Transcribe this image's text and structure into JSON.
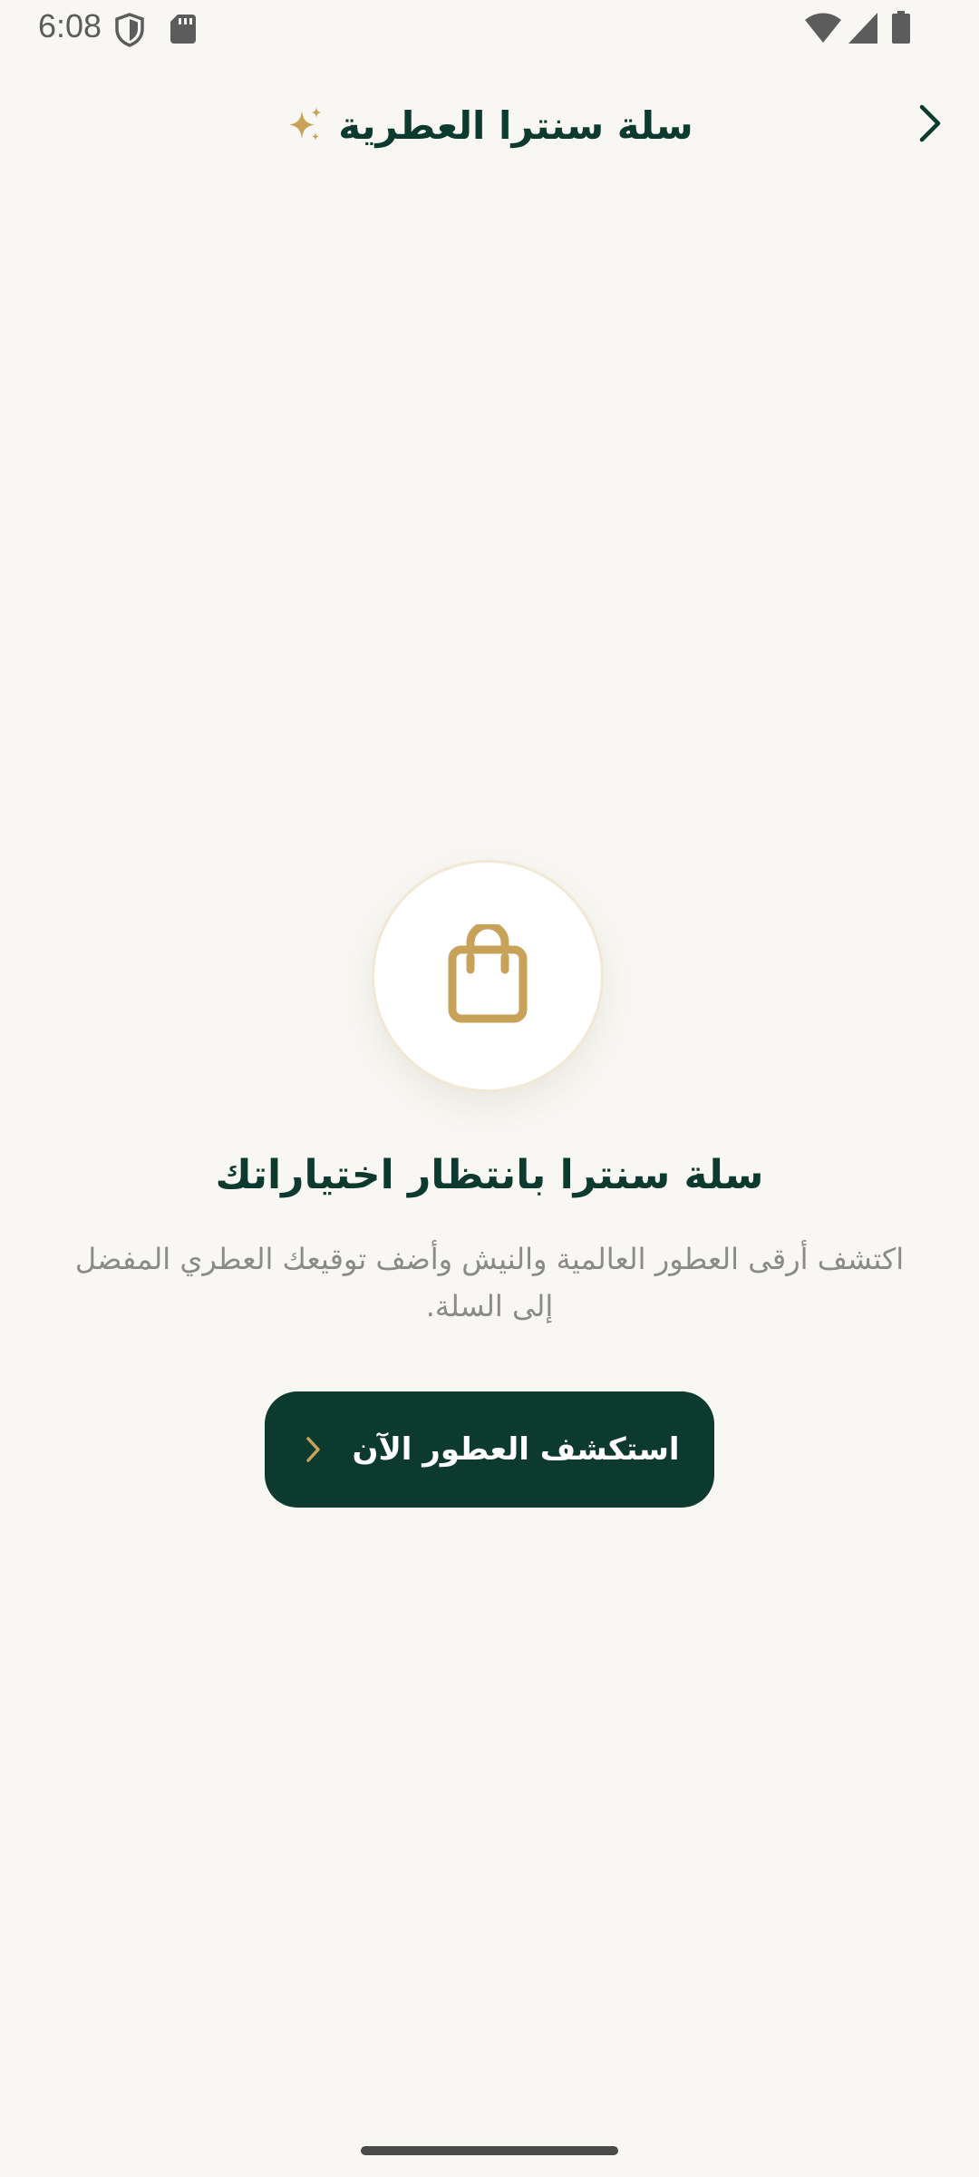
{
  "status_bar": {
    "time": "6:08",
    "icons_left": [
      "shield-icon",
      "sd-card-icon"
    ],
    "icons_right": [
      "wifi-icon",
      "signal-icon",
      "battery-icon"
    ]
  },
  "header": {
    "title": "سلة سنترا العطرية",
    "title_icon": "sparkle-icon",
    "back_icon": "chevron-right-icon"
  },
  "empty_state": {
    "icon": "shopping-bag-icon",
    "title": "سلة سنترا بانتظار اختياراتك",
    "description": "اكتشف أرقى العطور العالمية والنيش وأضف توقيعك العطري المفضل إلى السلة."
  },
  "cta": {
    "label": "استكشف العطور الآن",
    "icon": "chevron-left-icon"
  },
  "colors": {
    "background": "#f8f7f3",
    "primary": "#0d3a2e",
    "accent": "#c9a25a",
    "muted_text": "#8a8a8a"
  }
}
